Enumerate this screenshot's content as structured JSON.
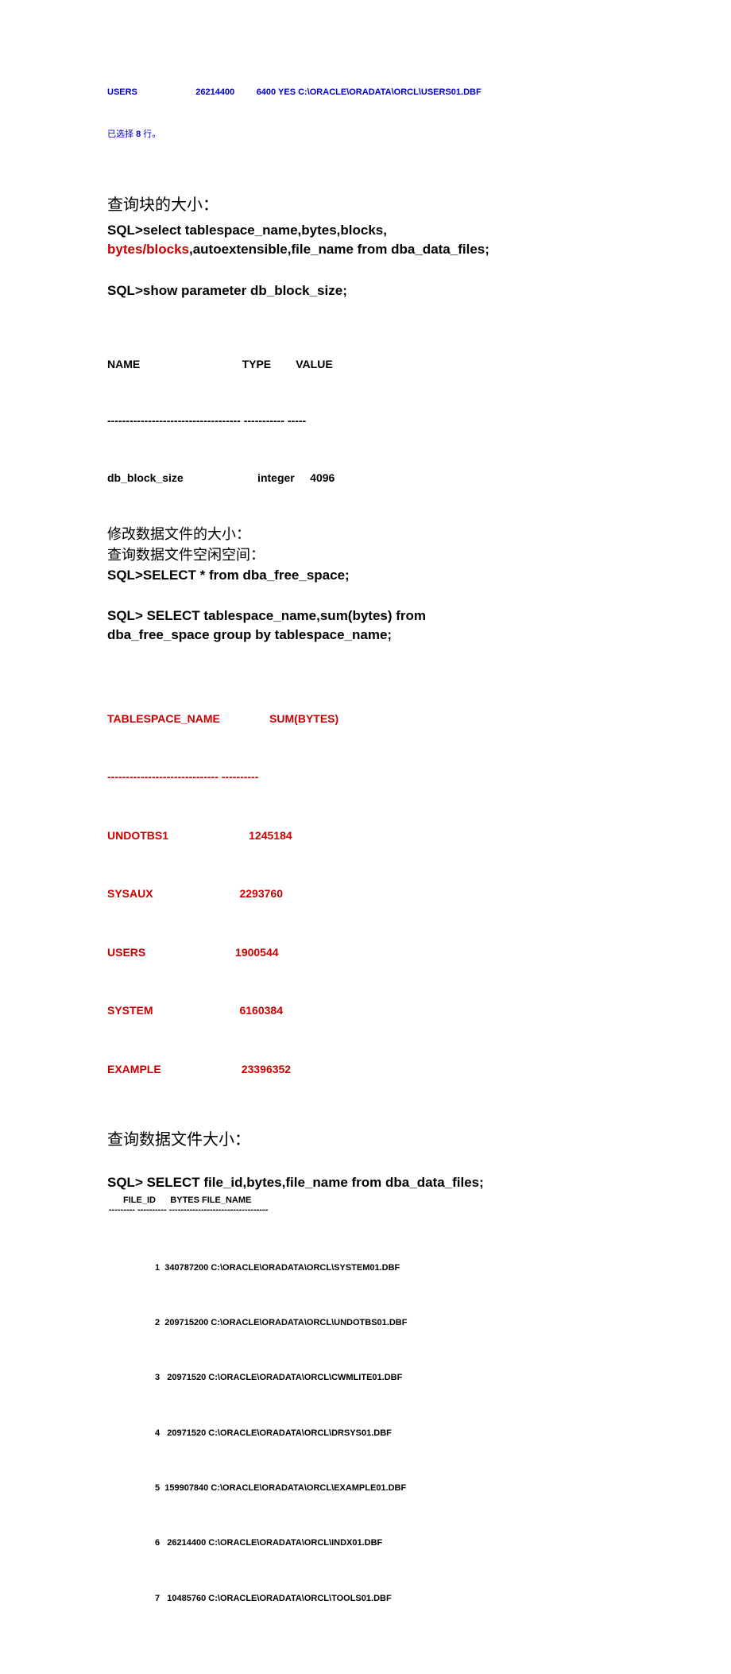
{
  "top_row": "USERS                        26214400         6400 YES C:\\ORACLE\\ORADATA\\ORCL\\USERS01.DBF",
  "selected_prefix": "已选择 ",
  "selected_count": "8",
  "selected_suffix": " 行。",
  "heading_block_size": " 查询块的大小：",
  "sql1_prefix": "SQL>select tablespace_name,bytes,blocks,",
  "sql1_red": "bytes/blocks",
  "sql1_suffix": ",autoextensible,file_name from dba_data_files;",
  "sql2": "SQL>show parameter db_block_size;",
  "param_header": "NAME                                 TYPE        VALUE",
  "param_sep": "------------------------------------ ----------- -----",
  "param_row": "db_block_size                        integer     4096",
  "text_modify": "修改数据文件的大小：",
  "text_query_free": "查询数据文件空闲空间：",
  "sql3": "SQL>SELECT * from dba_free_space;",
  "sql4_line1": "SQL> SELECT tablespace_name,sum(bytes) from",
  "sql4_line2": "dba_free_space group by tablespace_name;",
  "free_header": "TABLESPACE_NAME                SUM(BYTES)",
  "free_sep": "------------------------------ ----------",
  "free_rows": [
    "UNDOTBS1                          1245184",
    "SYSAUX                            2293760",
    "USERS                             1900544",
    "SYSTEM                            6160384",
    "EXAMPLE                          23396352"
  ],
  "heading_file_size": " 查询数据文件大小：",
  "sql5": "SQL> SELECT file_id,bytes,file_name from dba_data_files;",
  "file_header": "FILE_ID      BYTES FILE_NAME",
  "file_sep": "--------- ---------- ----------------------------------",
  "file_rows": [
    "1  340787200 C:\\ORACLE\\ORADATA\\ORCL\\SYSTEM01.DBF",
    "2  209715200 C:\\ORACLE\\ORADATA\\ORCL\\UNDOTBS01.DBF",
    "3   20971520 C:\\ORACLE\\ORADATA\\ORCL\\CWMLITE01.DBF",
    "4   20971520 C:\\ORACLE\\ORADATA\\ORCL\\DRSYS01.DBF",
    "5  159907840 C:\\ORACLE\\ORADATA\\ORCL\\EXAMPLE01.DBF",
    "6   26214400 C:\\ORACLE\\ORADATA\\ORCL\\INDX01.DBF",
    "7   10485760 C:\\ORACLE\\ORADATA\\ORCL\\TOOLS01.DBF"
  ]
}
